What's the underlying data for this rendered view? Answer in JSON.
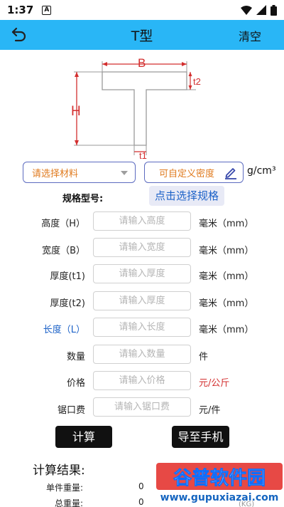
{
  "status": {
    "time": "1:37",
    "notif_icon": "A"
  },
  "header": {
    "title": "T型",
    "clear_label": "清空"
  },
  "diagram": {
    "B": "B",
    "H": "H",
    "t1": "t1",
    "t2": "t2"
  },
  "material": {
    "placeholder": "请选择材料"
  },
  "density": {
    "placeholder": "可自定义密度",
    "unit": "g/cm³"
  },
  "spec": {
    "label": "规格型号:",
    "button": "点击选择规格"
  },
  "rows": [
    {
      "label": "高度（H）",
      "placeholder": "请输入高度",
      "unit": "毫米（mm）"
    },
    {
      "label": "宽度（B）",
      "placeholder": "请输入宽度",
      "unit": "毫米（mm）"
    },
    {
      "label": "厚度(t1)",
      "placeholder": "请输入厚度",
      "unit": "毫米（mm）"
    },
    {
      "label": "厚度(t2)",
      "placeholder": "请输入厚度",
      "unit": "毫米（mm）"
    },
    {
      "label": "长度（L）",
      "placeholder": "请输入长度",
      "unit": "毫米（mm）"
    },
    {
      "label": "数量",
      "placeholder": "请输入数量",
      "unit": "件"
    },
    {
      "label": "价格",
      "placeholder": "请输入价格",
      "unit": "元/公斤"
    },
    {
      "label": "锯口费",
      "placeholder": "请输入锯口费",
      "unit": "元/件"
    }
  ],
  "actions": {
    "calc": "计算",
    "export": "导至手机"
  },
  "results": {
    "title": "计算结果:",
    "unit_weight_label": "单件重量:",
    "unit_weight_value": "0",
    "total_weight_label": "总重量:",
    "total_weight_value": "0",
    "kg_partial": "(KG)"
  },
  "watermark": {
    "brand": "谷普软件园",
    "url": "www.gupuxiazai.com"
  },
  "colors": {
    "appbar": "#29b6f6",
    "accent": "#1e63c8",
    "orange": "#e07b1f",
    "red": "#d32f2f"
  }
}
